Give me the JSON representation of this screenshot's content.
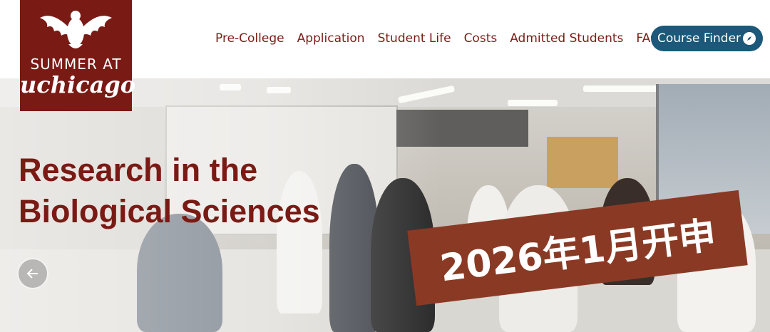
{
  "logo": {
    "top_text": "SUMMER AT",
    "bottom_text": "uchicago",
    "icon": "phoenix-icon"
  },
  "nav": {
    "items": [
      "Pre-College",
      "Application",
      "Student Life",
      "Costs",
      "Admitted Students",
      "FAQ"
    ],
    "course_finder_label": "Course Finder",
    "course_finder_icon": "compass-icon"
  },
  "hero": {
    "title_line1": "Research in the",
    "title_line2": "Biological Sciences",
    "banner_text": "2026年1月开申",
    "prev_icon": "arrow-left-icon"
  },
  "colors": {
    "brand": "#7a1a14",
    "button": "#1b5879",
    "banner": "#8a3a24"
  }
}
